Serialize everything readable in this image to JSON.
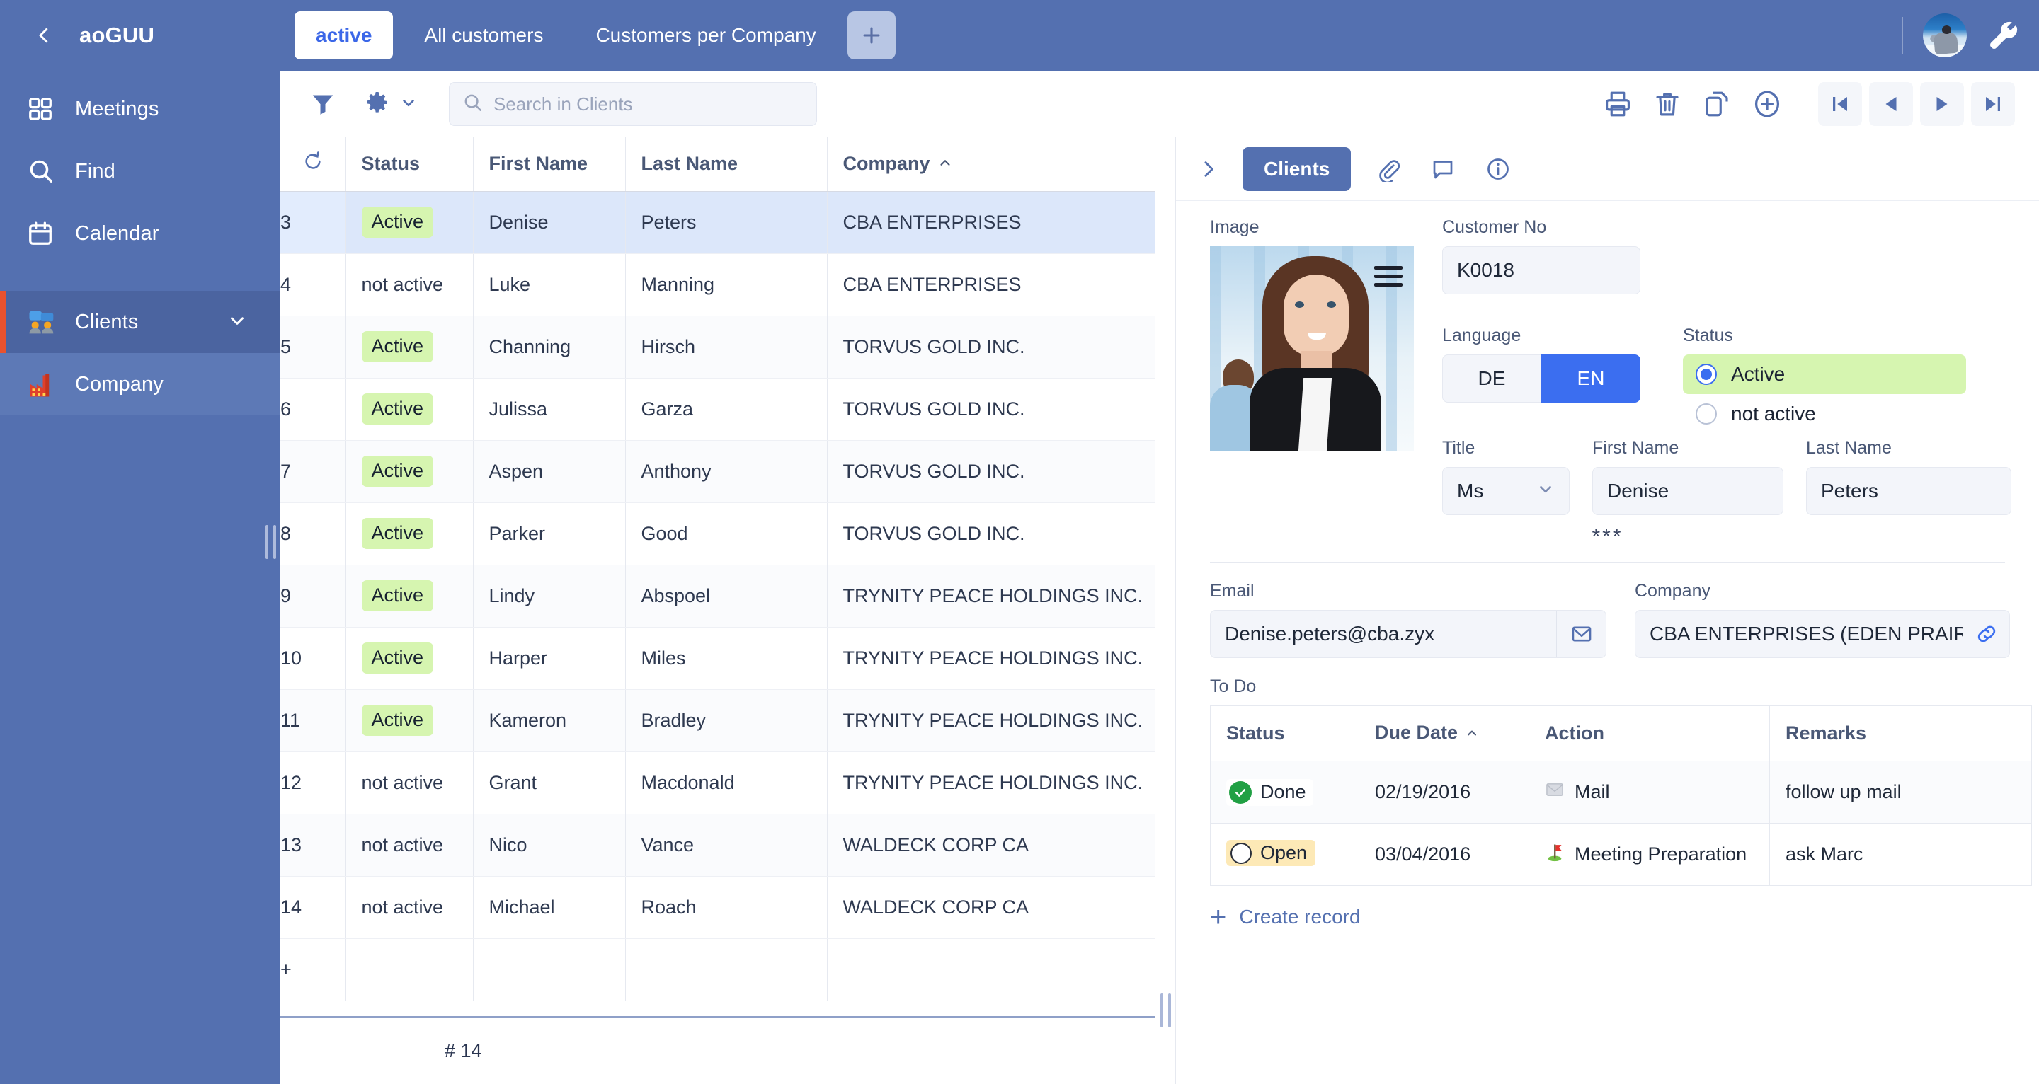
{
  "sidebar": {
    "back_icon": "chevron-left-icon",
    "title": "aoGUU",
    "items": [
      {
        "label": "Meetings",
        "icon": "grid-icon"
      },
      {
        "label": "Find",
        "icon": "search-icon"
      },
      {
        "label": "Calendar",
        "icon": "calendar-icon"
      },
      {
        "label": "Clients",
        "icon": "clients-icon",
        "chevron": "chevron-down-icon"
      },
      {
        "label": "Company",
        "icon": "factory-icon"
      }
    ]
  },
  "tabbar": {
    "tabs": [
      {
        "label": "active",
        "selected": true
      },
      {
        "label": "All customers",
        "selected": false
      },
      {
        "label": "Customers per Company",
        "selected": false
      }
    ],
    "add_tab_icon": "plus-icon",
    "avatar_icon": "user-avatar",
    "settings_icon": "wrench-icon"
  },
  "toolbar": {
    "filter_icon": "filter-icon",
    "gear_icon": "gear-icon",
    "gear_chevron_icon": "chevron-down-icon",
    "search": {
      "value": "",
      "placeholder": "Search in Clients"
    },
    "actions": [
      {
        "icon": "print-icon"
      },
      {
        "icon": "trash-icon"
      },
      {
        "icon": "copy-icon"
      },
      {
        "icon": "plus-circle-icon"
      }
    ],
    "nav": [
      {
        "icon": "first-page-icon"
      },
      {
        "icon": "prev-page-icon"
      },
      {
        "icon": "next-page-icon"
      },
      {
        "icon": "last-page-icon"
      }
    ]
  },
  "grid": {
    "refresh_icon": "refresh-icon",
    "columns": [
      "Status",
      "First Name",
      "Last Name",
      "Company"
    ],
    "sorted_column": "Company",
    "sort_direction_icon": "caret-up-icon",
    "rows": [
      {
        "idx": "3",
        "status": "Active",
        "first": "Denise",
        "last": "Peters",
        "company": "CBA ENTERPRISES"
      },
      {
        "idx": "4",
        "status": "not active",
        "first": "Luke",
        "last": "Manning",
        "company": "CBA ENTERPRISES"
      },
      {
        "idx": "5",
        "status": "Active",
        "first": "Channing",
        "last": "Hirsch",
        "company": "TORVUS GOLD INC."
      },
      {
        "idx": "6",
        "status": "Active",
        "first": "Julissa",
        "last": "Garza",
        "company": "TORVUS GOLD INC."
      },
      {
        "idx": "7",
        "status": "Active",
        "first": "Aspen",
        "last": "Anthony",
        "company": "TORVUS GOLD INC."
      },
      {
        "idx": "8",
        "status": "Active",
        "first": "Parker",
        "last": "Good",
        "company": "TORVUS GOLD INC."
      },
      {
        "idx": "9",
        "status": "Active",
        "first": "Lindy",
        "last": "Abspoel",
        "company": "TRYNITY PEACE HOLDINGS INC."
      },
      {
        "idx": "10",
        "status": "Active",
        "first": "Harper",
        "last": "Miles",
        "company": "TRYNITY PEACE HOLDINGS INC."
      },
      {
        "idx": "11",
        "status": "Active",
        "first": "Kameron",
        "last": "Bradley",
        "company": "TRYNITY PEACE HOLDINGS INC."
      },
      {
        "idx": "12",
        "status": "not active",
        "first": "Grant",
        "last": "Macdonald",
        "company": "TRYNITY PEACE HOLDINGS INC."
      },
      {
        "idx": "13",
        "status": "not active",
        "first": "Nico",
        "last": "Vance",
        "company": "WALDECK CORP CA"
      },
      {
        "idx": "14",
        "status": "not active",
        "first": "Michael",
        "last": "Roach",
        "company": "WALDECK CORP CA"
      }
    ],
    "add_row_icon": "plus-icon",
    "record_count": "# 14"
  },
  "panel": {
    "collapse_icon": "chevron-right-icon",
    "tab_label": "Clients",
    "icons": [
      {
        "icon": "paperclip-icon"
      },
      {
        "icon": "comment-icon"
      },
      {
        "icon": "info-icon"
      }
    ],
    "image_label": "Image",
    "image_menu_icon": "hamburger-icon",
    "customer_no": {
      "label": "Customer No",
      "value": "K0018"
    },
    "language": {
      "label": "Language",
      "options": [
        "DE",
        "EN"
      ],
      "selected": "EN"
    },
    "status": {
      "label": "Status",
      "options": [
        "Active",
        "not active"
      ],
      "selected": "Active"
    },
    "title_field": {
      "label": "Title",
      "value": "Ms",
      "chevron_icon": "chevron-down-icon"
    },
    "first_name": {
      "label": "First Name",
      "value": "Denise"
    },
    "last_name": {
      "label": "Last Name",
      "value": "Peters"
    },
    "separator": "***",
    "email": {
      "label": "Email",
      "value": "Denise.peters@cba.zyx",
      "icon": "envelope-icon"
    },
    "company": {
      "label": "Company",
      "value": "CBA ENTERPRISES (EDEN PRAIR",
      "icon": "link-icon"
    },
    "todo": {
      "label": "To Do",
      "columns": [
        "Status",
        "Due Date",
        "Action",
        "Remarks"
      ],
      "sorted_column": "Due Date",
      "sort_direction_icon": "caret-up-icon",
      "rows": [
        {
          "status": "Done",
          "date": "02/19/2016",
          "action": "Mail",
          "action_icon": "mail-emoji",
          "remarks": "follow up mail"
        },
        {
          "status": "Open",
          "date": "03/04/2016",
          "action": "Meeting Preparation",
          "action_icon": "golf-flag-emoji",
          "remarks": "ask Marc"
        }
      ],
      "create_label": "Create record",
      "create_icon": "plus-icon"
    }
  },
  "colors": {
    "brand_blue": "#5470b0",
    "accent_blue": "#3b6ef0",
    "active_green": "#d6f5b0",
    "open_amber": "#fde9b6",
    "done_green": "#21a044",
    "selected_row": "#dce7fa"
  }
}
